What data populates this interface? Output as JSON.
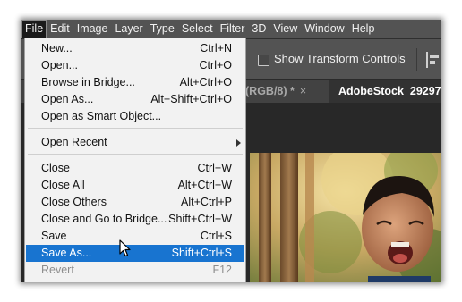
{
  "menubar": [
    "File",
    "Edit",
    "Image",
    "Layer",
    "Type",
    "Select",
    "Filter",
    "3D",
    "View",
    "Window",
    "Help"
  ],
  "options": {
    "show_transform_label": "Show Transform Controls",
    "show_transform_checked": false
  },
  "tabs": [
    {
      "label": "(RGB/8) *",
      "close": "×",
      "active": false
    },
    {
      "label": "AdobeStock_29297",
      "active": true
    }
  ],
  "file_menu": {
    "items": [
      {
        "label": "New...",
        "shortcut": "Ctrl+N"
      },
      {
        "label": "Open...",
        "shortcut": "Ctrl+O"
      },
      {
        "label": "Browse in Bridge...",
        "shortcut": "Alt+Ctrl+O"
      },
      {
        "label": "Open As...",
        "shortcut": "Alt+Shift+Ctrl+O"
      },
      {
        "label": "Open as Smart Object...",
        "shortcut": ""
      },
      {
        "label": "Open Recent",
        "shortcut": "",
        "submenu": true
      },
      {
        "label": "Close",
        "shortcut": "Ctrl+W"
      },
      {
        "label": "Close All",
        "shortcut": "Alt+Ctrl+W"
      },
      {
        "label": "Close Others",
        "shortcut": "Alt+Ctrl+P"
      },
      {
        "label": "Close and Go to Bridge...",
        "shortcut": "Shift+Ctrl+W"
      },
      {
        "label": "Save",
        "shortcut": "Ctrl+S"
      },
      {
        "label": "Save As...",
        "shortcut": "Shift+Ctrl+S",
        "highlighted": true
      },
      {
        "label": "Revert",
        "shortcut": "F12",
        "disabled": true
      }
    ]
  },
  "colors": {
    "menubar": "#535353",
    "highlight": "#1874d0",
    "menu_bg": "#f2f2f2"
  },
  "icons": [
    "submenu-arrow-icon",
    "mouse-pointer-icon",
    "align-left-icon",
    "checkbox-icon"
  ]
}
